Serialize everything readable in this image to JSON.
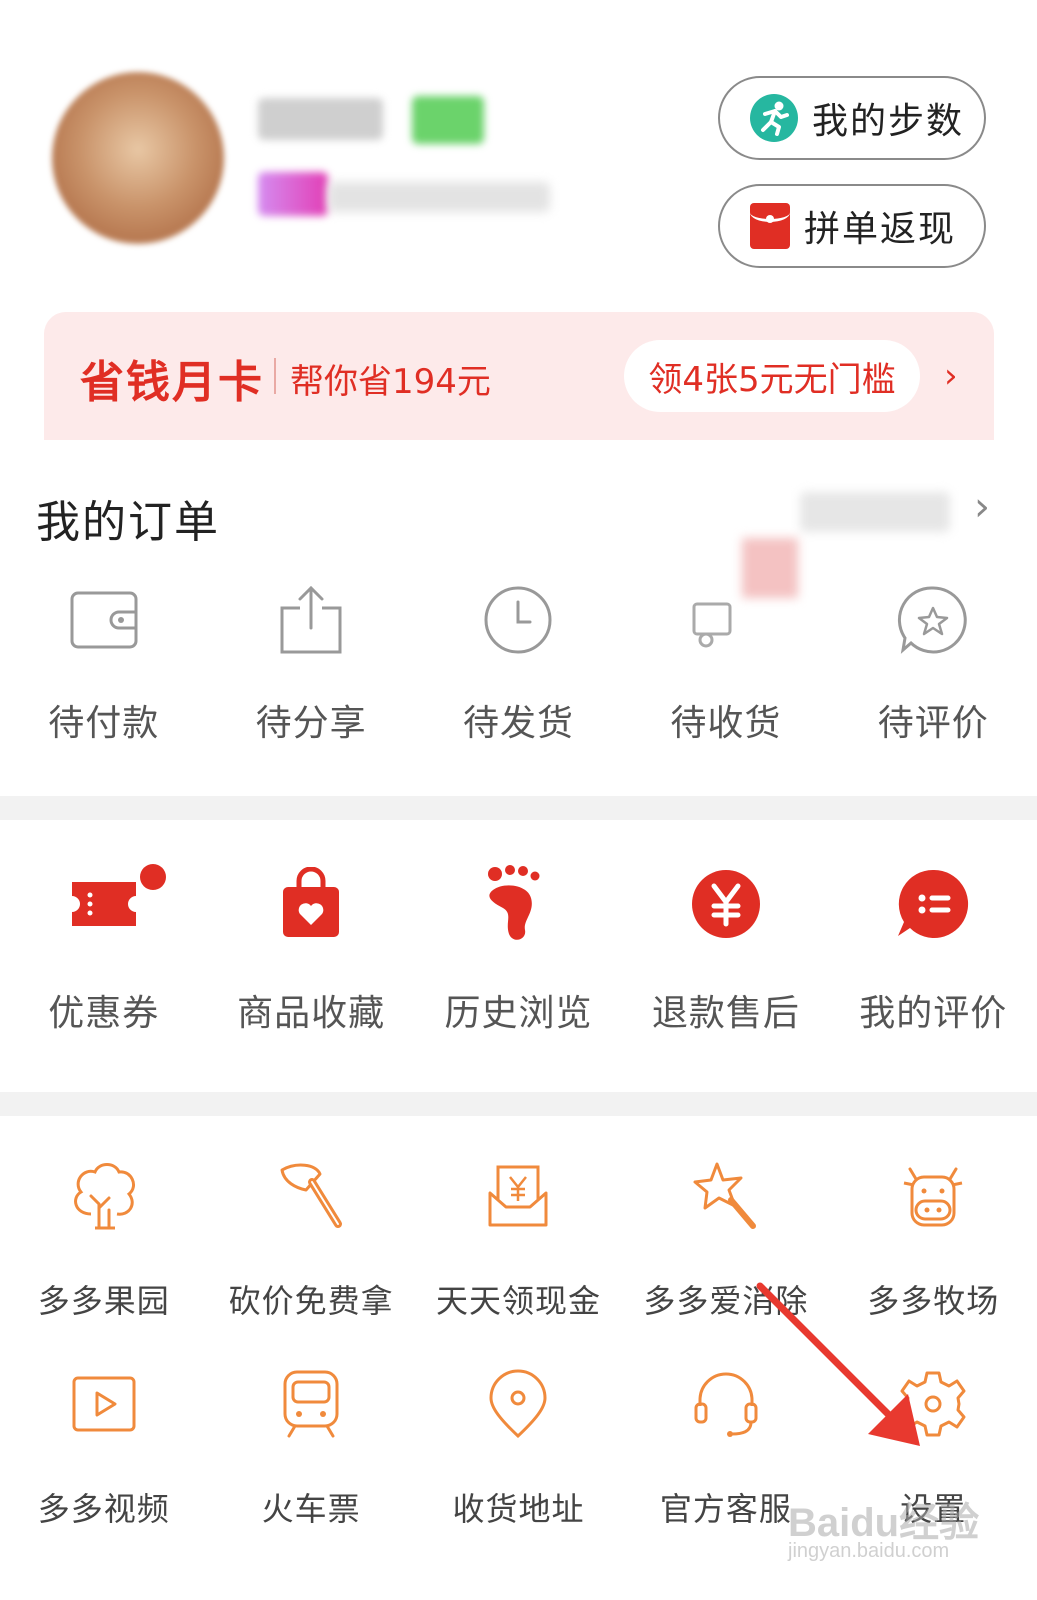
{
  "header": {
    "steps_label": "我的步数",
    "rebate_label": "拼单返现"
  },
  "savings_card": {
    "title": "省钱月卡",
    "subtitle": "帮你省194元",
    "offer": "领4张5元无门槛",
    "arrow": "›"
  },
  "orders": {
    "title": "我的订单",
    "arrow": "›",
    "items": [
      {
        "label": "待付款",
        "icon": "wallet-icon"
      },
      {
        "label": "待分享",
        "icon": "share-icon"
      },
      {
        "label": "待发货",
        "icon": "clock-icon"
      },
      {
        "label": "待收货",
        "icon": "truck-icon"
      },
      {
        "label": "待评价",
        "icon": "star-bubble-icon"
      }
    ]
  },
  "services": {
    "items": [
      {
        "label": "优惠券",
        "icon": "coupon-icon"
      },
      {
        "label": "商品收藏",
        "icon": "favorite-bag-icon"
      },
      {
        "label": "历史浏览",
        "icon": "footprint-icon"
      },
      {
        "label": "退款售后",
        "icon": "yuan-icon"
      },
      {
        "label": "我的评价",
        "icon": "comment-icon"
      }
    ]
  },
  "tools": {
    "row1": [
      {
        "label": "多多果园",
        "icon": "tree-icon"
      },
      {
        "label": "砍价免费拿",
        "icon": "axe-icon"
      },
      {
        "label": "天天领现金",
        "icon": "cash-envelope-icon"
      },
      {
        "label": "多多爱消除",
        "icon": "star-wand-icon"
      },
      {
        "label": "多多牧场",
        "icon": "cow-icon"
      }
    ],
    "row2": [
      {
        "label": "多多视频",
        "icon": "video-icon"
      },
      {
        "label": "火车票",
        "icon": "train-icon"
      },
      {
        "label": "收货地址",
        "icon": "location-icon"
      },
      {
        "label": "官方客服",
        "icon": "headset-icon"
      },
      {
        "label": "设置",
        "icon": "gear-icon"
      }
    ]
  },
  "watermark": {
    "brand": "Baidu经验",
    "url": "jingyan.baidu.com"
  },
  "colors": {
    "brand_red": "#e02e24",
    "tool_orange": "#f08a3c",
    "steps_teal": "#26b7a0"
  }
}
